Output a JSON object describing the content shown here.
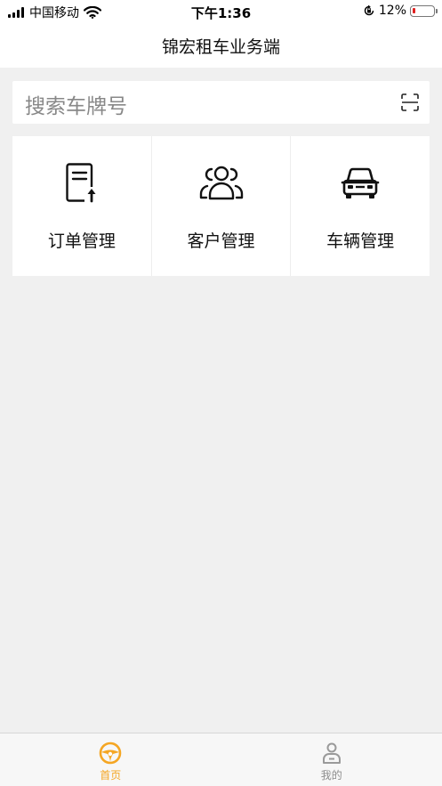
{
  "status_bar": {
    "carrier": "中国移动",
    "time": "下午1:36",
    "battery_percent": "12%",
    "battery_level": 0.12
  },
  "header": {
    "title": "锦宏租车业务端"
  },
  "search": {
    "placeholder": "搜索车牌号",
    "scan_icon": "scan-icon"
  },
  "menu": {
    "items": [
      {
        "label": "订单管理",
        "icon": "document-upload-icon"
      },
      {
        "label": "客户管理",
        "icon": "users-icon"
      },
      {
        "label": "车辆管理",
        "icon": "car-icon"
      }
    ]
  },
  "tabbar": {
    "items": [
      {
        "label": "首页",
        "icon": "steering-wheel-icon",
        "active": true
      },
      {
        "label": "我的",
        "icon": "person-icon",
        "active": false
      }
    ],
    "active_color": "#f5a623",
    "inactive_color": "#8e8e8e"
  }
}
